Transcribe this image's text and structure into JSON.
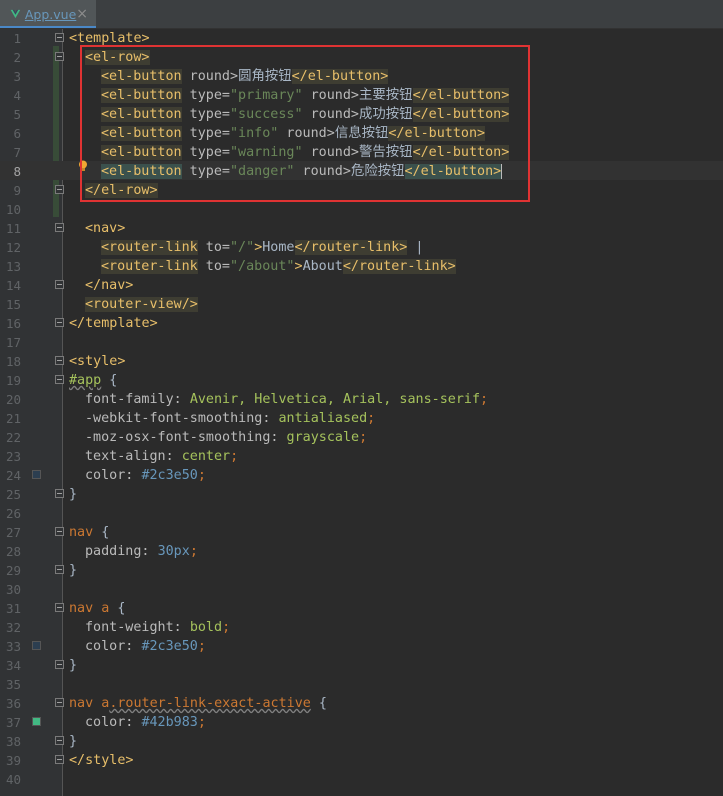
{
  "tab": {
    "label": "App.vue",
    "close": "×"
  },
  "line_numbers": [
    "1",
    "2",
    "3",
    "4",
    "5",
    "6",
    "7",
    "8",
    "9",
    "10",
    "11",
    "12",
    "13",
    "14",
    "15",
    "16",
    "17",
    "18",
    "19",
    "20",
    "21",
    "22",
    "23",
    "24",
    "25",
    "26",
    "27",
    "28",
    "29",
    "30",
    "31",
    "32",
    "33",
    "34",
    "35",
    "36",
    "37",
    "38",
    "39",
    "40"
  ],
  "code": {
    "l1": "<template>",
    "l2": "<el-row>",
    "btn_open": "<el-button",
    "btn_close": "</el-button>",
    "l3_attr": " round>",
    "l3_text": "圆角按钮",
    "type_attr": " type=",
    "round_attr": " round>",
    "l4_val": "\"primary\"",
    "l4_text": "主要按钮",
    "l5_val": "\"success\"",
    "l5_text": "成功按钮",
    "l6_val": "\"info\"",
    "l6_text": "信息按钮",
    "l7_val": "\"warning\"",
    "l7_text": "警告按钮",
    "l8_val": "\"danger\"",
    "l8_text": "危险按钮",
    "l9": "</el-row>",
    "l11": "<nav>",
    "rl_open": "<router-link",
    "rl_close": "</router-link>",
    "to_attr": " to=",
    "l12_val": "\"/\"",
    "l12_text": "Home",
    "l12_pipe": " |",
    "l13_val": "\"/about\"",
    "l13_text": "About",
    "l14": "</nav>",
    "l15": "<router-view/>",
    "l16": "</template>",
    "l18": "<style>",
    "l19_sel": "#app",
    "brace_open": " {",
    "brace_close": "}",
    "l20_prop": "font-family: ",
    "l20_val": "Avenir, Helvetica, Arial, sans-serif",
    "l21_prop": "-webkit-font-smoothing: ",
    "l21_val": "antialiased",
    "l22_prop": "-moz-osx-font-smoothing: ",
    "l22_val": "grayscale",
    "l23_prop": "text-align: ",
    "l23_val": "center",
    "l24_prop": "color: ",
    "l24_val": "#2c3e50",
    "l27_sel": "nav",
    "l28_prop": "padding: ",
    "l28_val": "30px",
    "l31_sel": "nav a",
    "l32_prop": "font-weight: ",
    "l32_val": "bold",
    "l33_prop": "color: ",
    "l33_val": "#2c3e50",
    "l36_sel1": "nav a",
    "l36_sel2": ".router-link-exact-active",
    "l37_prop": "color: ",
    "l37_val": "#42b983",
    "l39": "</style>",
    "semi": ";"
  },
  "swatches": {
    "l24": "#2c3e50",
    "l33": "#2c3e50",
    "l37": "#42b983"
  }
}
